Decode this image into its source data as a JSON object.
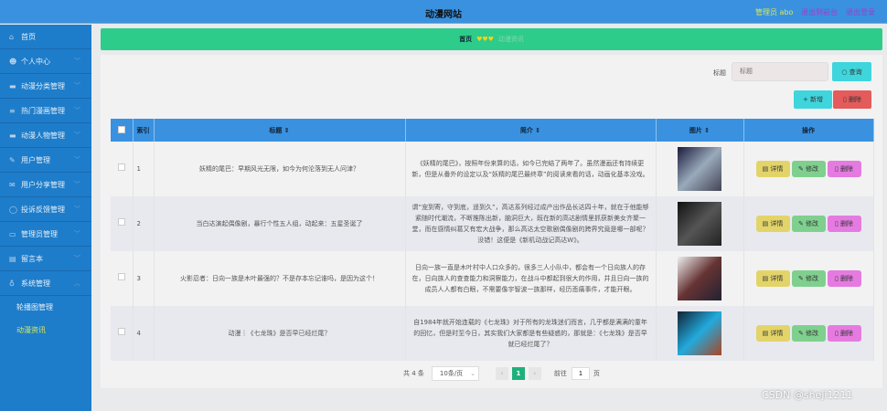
{
  "header": {
    "title": "动漫网站",
    "user": "管理员 abo",
    "to_front": "退出到前台",
    "logout": "退出登录"
  },
  "sidebar": {
    "items": [
      {
        "label": "首页",
        "icon": "home-icon"
      },
      {
        "label": "个人中心",
        "icon": "user-icon"
      },
      {
        "label": "动漫分类管理",
        "icon": "monitor-icon"
      },
      {
        "label": "热门漫画管理",
        "icon": "list-icon"
      },
      {
        "label": "动漫人物管理",
        "icon": "monitor-icon"
      },
      {
        "label": "用户管理",
        "icon": "edit-icon"
      },
      {
        "label": "用户分享管理",
        "icon": "mail-icon"
      },
      {
        "label": "投诉反馈管理",
        "icon": "globe-icon"
      },
      {
        "label": "管理员管理",
        "icon": "chat-icon"
      },
      {
        "label": "留言本",
        "icon": "clipboard-icon"
      },
      {
        "label": "系统管理",
        "icon": "mic-icon"
      }
    ],
    "sub_items": [
      {
        "label": "轮播图管理"
      },
      {
        "label": "动漫资讯"
      }
    ]
  },
  "breadcrumb": {
    "home": "首页",
    "hearts": "♥♥♥",
    "current": "动漫资讯"
  },
  "search": {
    "label": "标题",
    "placeholder": "标题",
    "query": "查询",
    "add": "新增",
    "delete": "删除"
  },
  "table": {
    "headers": {
      "index": "索引",
      "title": "标题",
      "intro": "简介",
      "image": "图片",
      "ops": "操作"
    },
    "actions": {
      "detail": "详情",
      "edit": "修改",
      "delete": "删除"
    },
    "rows": [
      {
        "index": "1",
        "title": "妖精的尾巴：早期风光无限，如今为何沦落到无人问津？",
        "intro": "《妖精的尾巴》，按照年份来算的话，如今已完结了两年了。虽然漫画还有持续更新，但是从番外的设定以及“妖精的尾巴最终章”的阅读来看的话，动画化基本没戏。"
      },
      {
        "index": "2",
        "title": "当白达演起偶像剧，暴行个性五人组，动起来：五星圣诞了",
        "intro": "谓“宠到寄，守到底，遥到久”，高达系列经过成产出作品长达四十年，就在于他能够紧随时代潮流，不断推陈出新，脑洞巨大，既在新的高达剧情里抓获新美女齐聚一堂，而在感情纠葛又有宏大战争，那么高达太空歌剧偶像剧的跨界究竟是哪一部呢？没错！这便是《新机动战记高达W》。"
      },
      {
        "index": "3",
        "title": "火影忍者：日向一族是木叶最强的？不是存本忘记谁吗，是因为这个！",
        "intro": "日向一族一直是木叶村中人口众多的，很多三人小队中，都会有一个日向族人的存在，日向族人的查查能力和洞察能力，在战斗中都起到很大的作用，并且日向一族的成员人人都有白眼，不需要像宇智波一族那样，经历悲痛事件，才能开眼。"
      },
      {
        "index": "4",
        "title": "动漫｜《七龙珠》是否早已经烂尾？",
        "intro": "自1984年就开始连载的《七龙珠》对于所有的龙珠迷们而言，几乎都是满满的童年的回忆，但是时至今日，其实我们大家都是有些疑惑的，那就是：《七龙珠》是否早就已经烂尾了？"
      }
    ]
  },
  "pagination": {
    "total": "共 4 条",
    "page_size": "10条/页",
    "prev": "‹",
    "current": "1",
    "next": "›",
    "goto": "前往",
    "goto_value": "1",
    "page_unit": "页"
  },
  "watermark": "CSDN @sheji1211"
}
